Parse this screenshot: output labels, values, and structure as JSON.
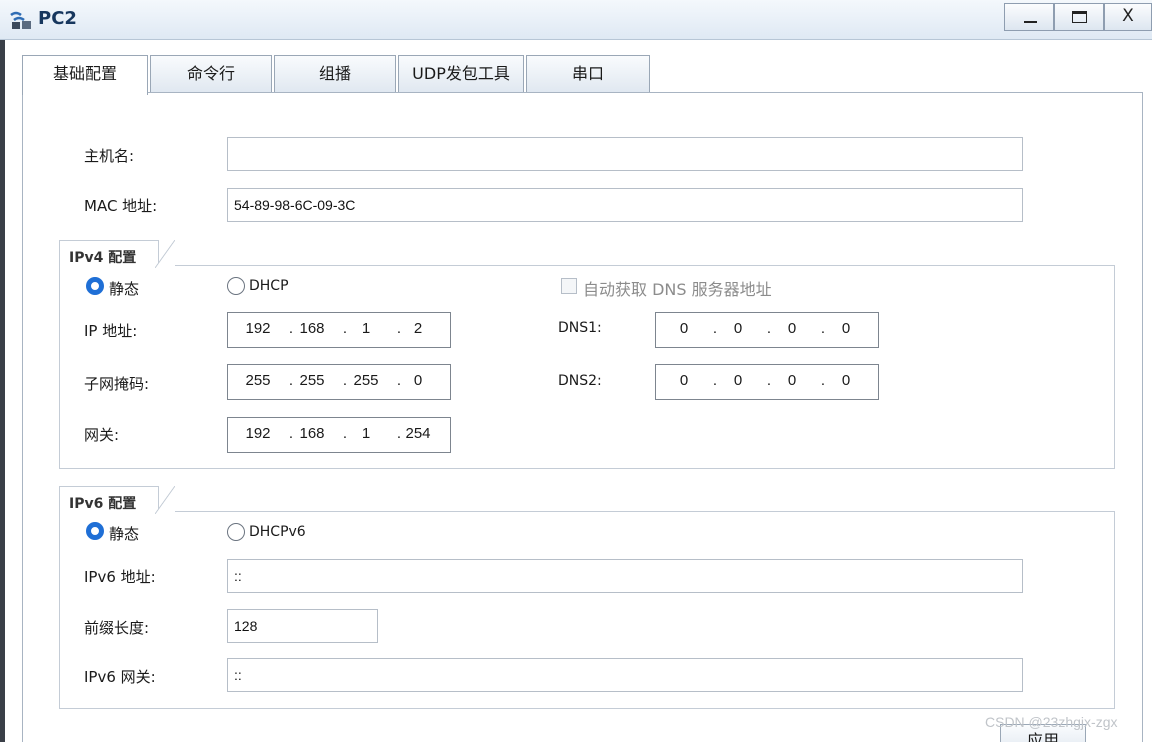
{
  "window": {
    "title": "PC2",
    "min": "—",
    "max": "",
    "close": "X"
  },
  "tabs": [
    "基础配置",
    "命令行",
    "组播",
    "UDP发包工具",
    "串口"
  ],
  "host": {
    "hostname_label": "主机名:",
    "hostname_value": "",
    "mac_label": "MAC 地址:",
    "mac_value": "54-89-98-6C-09-3C"
  },
  "ipv4": {
    "legend": "IPv4 配置",
    "static_label": "静态",
    "dhcp_label": "DHCP",
    "auto_dns_label": "自动获取 DNS 服务器地址",
    "ip_label": "IP 地址:",
    "ip": [
      "192",
      "168",
      "1",
      "2"
    ],
    "mask_label": "子网掩码:",
    "mask": [
      "255",
      "255",
      "255",
      "0"
    ],
    "gw_label": "网关:",
    "gw": [
      "192",
      "168",
      "1",
      "254"
    ],
    "dns1_label": "DNS1:",
    "dns1": [
      "0",
      "0",
      "0",
      "0"
    ],
    "dns2_label": "DNS2:",
    "dns2": [
      "0",
      "0",
      "0",
      "0"
    ],
    "dot": "."
  },
  "ipv6": {
    "legend": "IPv6 配置",
    "static_label": "静态",
    "dhcp_label": "DHCPv6",
    "addr_label": "IPv6 地址:",
    "addr_value": "::",
    "prefix_label": "前缀长度:",
    "prefix_value": "128",
    "gw_label": "IPv6 网关:",
    "gw_value": "::"
  },
  "apply_label": "应用",
  "watermark": "CSDN @23zhgjx-zgx"
}
